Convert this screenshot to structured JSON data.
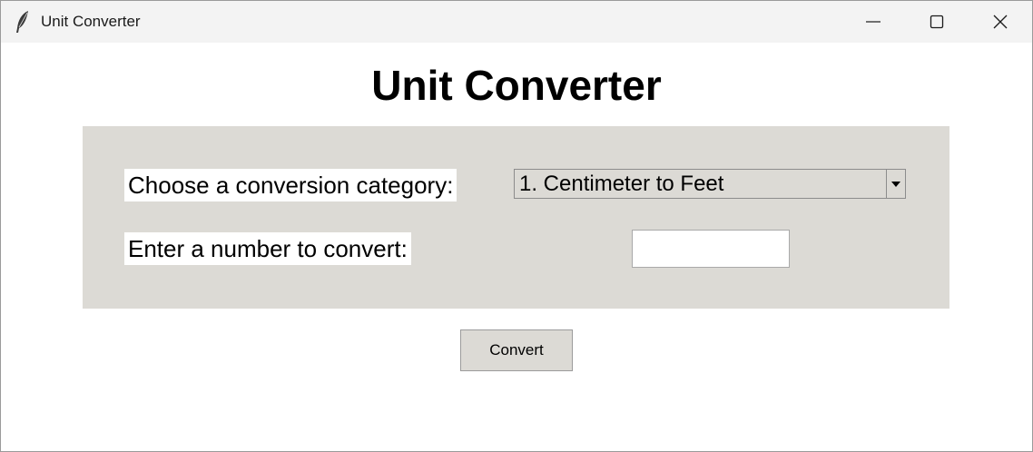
{
  "window": {
    "title": "Unit Converter",
    "app_icon": "feather-icon",
    "controls": {
      "minimize_icon": "minimize-icon",
      "maximize_icon": "maximize-icon",
      "close_icon": "close-icon"
    }
  },
  "main": {
    "heading": "Unit Converter",
    "category_label": "Choose a conversion category:",
    "category_selected": "1. Centimeter to Feet",
    "number_label": "Enter a number to convert:",
    "number_value": "",
    "convert_label": "Convert"
  },
  "colors": {
    "panel_bg": "#dcdad5",
    "titlebar_bg": "#f3f3f3",
    "window_bg": "#ffffff"
  }
}
